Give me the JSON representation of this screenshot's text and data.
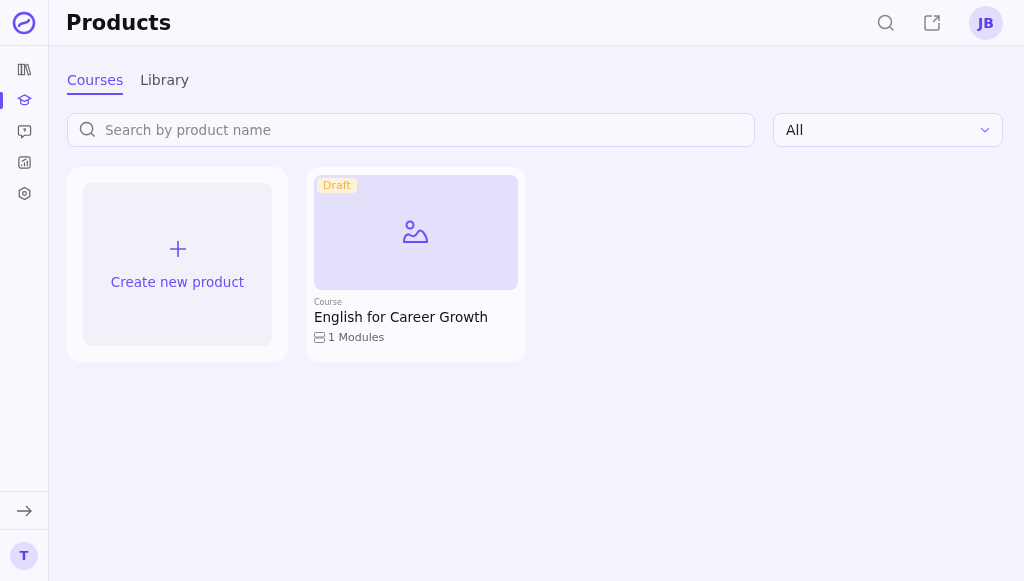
{
  "header": {
    "title": "Products",
    "avatar": "JB"
  },
  "sidebar": {
    "items": [
      {
        "kind": "library",
        "selected": false
      },
      {
        "kind": "courses",
        "selected": true
      },
      {
        "kind": "help",
        "selected": false
      },
      {
        "kind": "analytics",
        "selected": false
      },
      {
        "kind": "settings",
        "selected": false
      }
    ],
    "user_avatar": "T"
  },
  "tabs": [
    {
      "label": "Courses",
      "selected": true
    },
    {
      "label": "Library",
      "selected": false
    }
  ],
  "search": {
    "placeholder": "Search by product name"
  },
  "filter": {
    "value": "All"
  },
  "create_card": {
    "label": "Create new product"
  },
  "products": [
    {
      "badge": "Draft",
      "type": "Course",
      "title": "English for Career Growth",
      "modules": "1 Modules"
    }
  ]
}
